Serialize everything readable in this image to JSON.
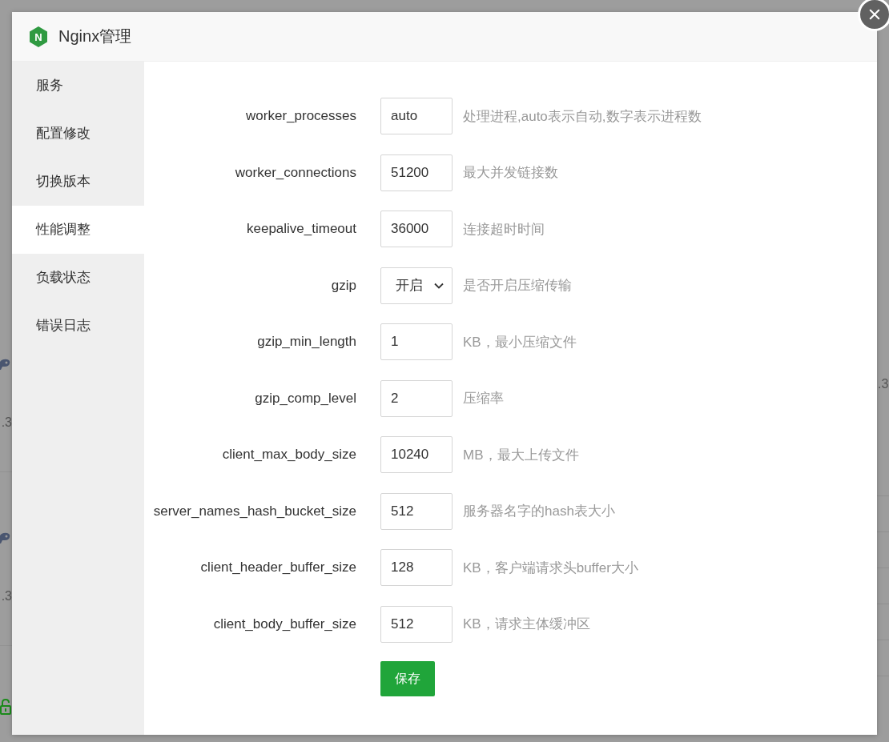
{
  "backdrop": {
    "left_rows": [
      {
        "version": ".3"
      },
      {
        "version": ".3"
      }
    ],
    "right_rows": [
      {
        "version": ".3"
      }
    ]
  },
  "dialog": {
    "logo_text": "N",
    "title": "Nginx管理"
  },
  "sidebar": {
    "items": [
      {
        "label": "服务",
        "selected": false
      },
      {
        "label": "配置修改",
        "selected": false
      },
      {
        "label": "切换版本",
        "selected": false
      },
      {
        "label": "性能调整",
        "selected": true
      },
      {
        "label": "负载状态",
        "selected": false
      },
      {
        "label": "错误日志",
        "selected": false
      }
    ]
  },
  "form": {
    "fields": [
      {
        "kind": "input",
        "label": "worker_processes",
        "value": "auto",
        "hint": "处理进程,auto表示自动,数字表示进程数"
      },
      {
        "kind": "input",
        "label": "worker_connections",
        "value": "51200",
        "hint": "最大并发链接数"
      },
      {
        "kind": "input",
        "label": "keepalive_timeout",
        "value": "36000",
        "hint": "连接超时时间"
      },
      {
        "kind": "select",
        "label": "gzip",
        "value": "开启",
        "hint": "是否开启压缩传输"
      },
      {
        "kind": "input",
        "label": "gzip_min_length",
        "value": "1",
        "hint": "KB，最小压缩文件"
      },
      {
        "kind": "input",
        "label": "gzip_comp_level",
        "value": "2",
        "hint": "压缩率"
      },
      {
        "kind": "input",
        "label": "client_max_body_size",
        "value": "10240",
        "hint": "MB，最大上传文件"
      },
      {
        "kind": "input",
        "label": "server_names_hash_bucket_size",
        "value": "512",
        "hint": "服务器名字的hash表大小"
      },
      {
        "kind": "input",
        "label": "client_header_buffer_size",
        "value": "128",
        "hint": "KB，客户端请求头buffer大小"
      },
      {
        "kind": "input",
        "label": "client_body_buffer_size",
        "value": "512",
        "hint": "KB，请求主体缓冲区"
      }
    ],
    "save_button": "保存"
  }
}
